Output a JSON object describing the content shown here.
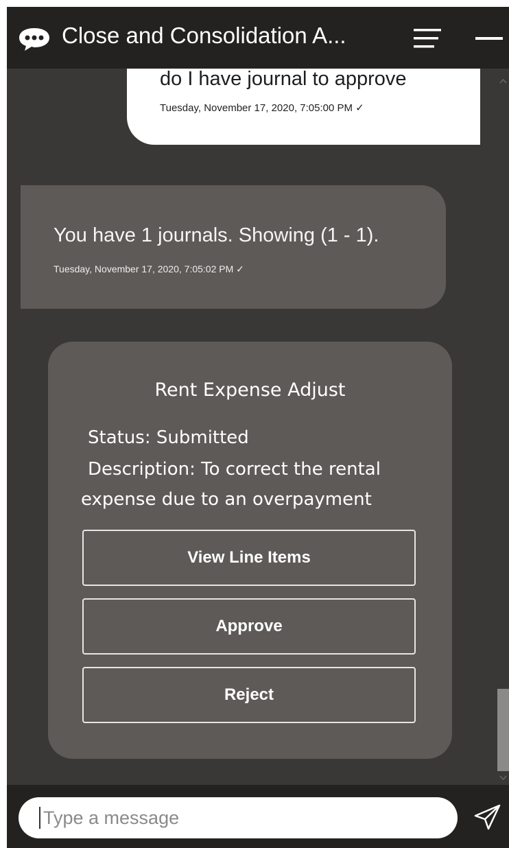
{
  "header": {
    "title": "Close and Consolidation A...",
    "icons": {
      "logo": "chat-bubble-icon",
      "menu": "menu-icon",
      "minimize": "minimize-icon"
    }
  },
  "messages": {
    "user": {
      "text": "do I have journal to approve",
      "timestamp": "Tuesday, November 17, 2020, 7:05:00 PM ✓"
    },
    "bot": {
      "text": "You have 1 journals. Showing (1 - 1).",
      "timestamp": "Tuesday, November 17, 2020, 7:05:02 PM ✓"
    }
  },
  "journal_card": {
    "title": "Rent Expense Adjust",
    "status": "Status: Submitted",
    "description_line1": "Description: To correct the rental",
    "description_line2": "expense due to an overpayment",
    "actions": [
      "View Line Items",
      "Approve",
      "Reject"
    ]
  },
  "composer": {
    "placeholder": "Type a message",
    "send_icon": "send-icon"
  },
  "colors": {
    "header_bg": "#242220",
    "chat_bg": "#3a3836",
    "bot_bubble": "#5e5a57",
    "user_bubble": "#ffffff",
    "button_border": "#e8e6e4"
  }
}
